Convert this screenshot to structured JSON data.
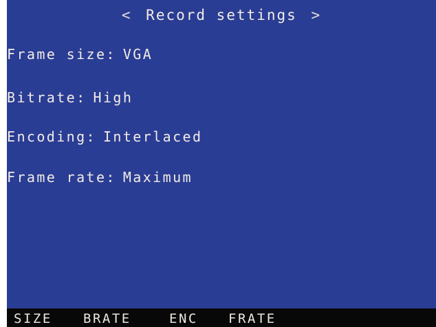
{
  "header": {
    "prev_arrow": "<",
    "title": "Record settings",
    "next_arrow": ">"
  },
  "settings": [
    {
      "label": "Frame size:",
      "value": "VGA"
    },
    {
      "label": "Bitrate:",
      "value": "High"
    },
    {
      "label": "Encoding:",
      "value": "Interlaced"
    },
    {
      "label": "Frame rate:",
      "value": "Maximum"
    }
  ],
  "softkeys": [
    "SIZE",
    "BRATE",
    "ENC",
    "FRATE"
  ],
  "colors": {
    "screen_background": "#2a3d94",
    "text": "#f2ece6",
    "softkey_bar": "#080808"
  }
}
